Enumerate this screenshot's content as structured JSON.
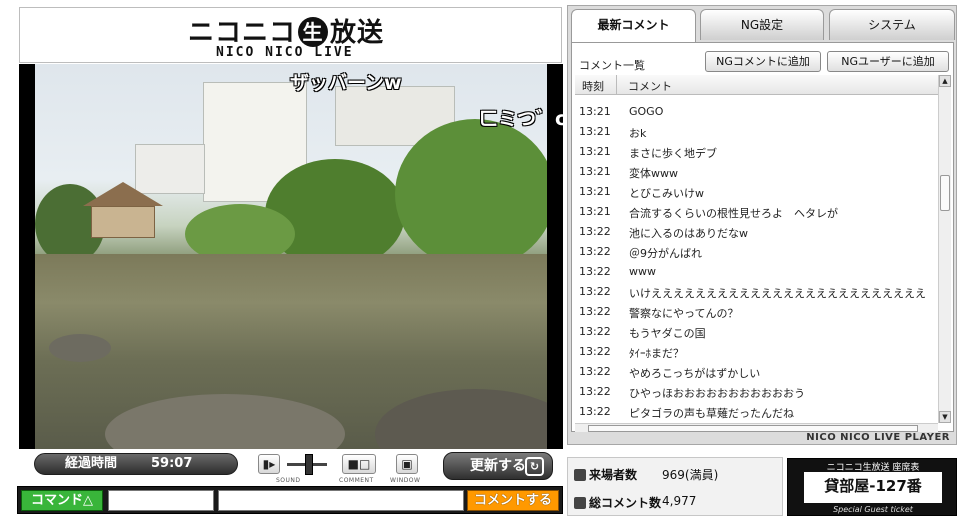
{
  "logo": {
    "main_a": "ニコニコ",
    "main_sei": "生",
    "main_b": "放送",
    "sub": "NICO NICO LIVE"
  },
  "video": {
    "overlay_comments": [
      "ザッバーンw",
      "ㄈミつ゛c"
    ]
  },
  "controls": {
    "elapsed_label": "経過時間",
    "elapsed_value": "59:07",
    "sound_label": "SOUND",
    "comment_label": "COMMENT",
    "window_label": "WINDOW",
    "refresh_label": "更新する"
  },
  "comment_bar": {
    "command_button": "コマンド△",
    "command_value": "",
    "comment_value": "",
    "send_button": "コメントする"
  },
  "tabs": [
    "最新コメント",
    "NG設定",
    "システム"
  ],
  "comment_panel": {
    "list_title": "コメント一覧",
    "ng_comment_button": "NGコメントに追加",
    "ng_user_button": "NGユーザーに追加",
    "headers": {
      "time": "時刻",
      "comment": "コメント"
    },
    "rows": [
      {
        "time": "13:21",
        "comment": "GOGO"
      },
      {
        "time": "13:21",
        "comment": "おk"
      },
      {
        "time": "13:21",
        "comment": "まさに歩く地デブ"
      },
      {
        "time": "13:21",
        "comment": "変体www"
      },
      {
        "time": "13:21",
        "comment": "とびこみいけw"
      },
      {
        "time": "13:21",
        "comment": "合流するくらいの根性見せろよ　ヘタレが"
      },
      {
        "time": "13:22",
        "comment": "池に入るのはありだなw"
      },
      {
        "time": "13:22",
        "comment": "＠9分がんばれ"
      },
      {
        "time": "13:22",
        "comment": "www"
      },
      {
        "time": "13:22",
        "comment": "いけえええええええええええええええええええええええええ"
      },
      {
        "time": "13:22",
        "comment": "警察なにやってんの？"
      },
      {
        "time": "13:22",
        "comment": "もうヤダこの国"
      },
      {
        "time": "13:22",
        "comment": "ﾀｲｰﾎまだ？"
      },
      {
        "time": "13:22",
        "comment": "やめろこっちがはずかしい"
      },
      {
        "time": "13:22",
        "comment": "ひやっほおおおおおおおおおおおう"
      },
      {
        "time": "13:22",
        "comment": "ピタゴラの声も草薙だったんだね"
      }
    ],
    "footer": "NICO NICO LIVE PLAYER"
  },
  "stats": {
    "visitors_label": "来場者数",
    "visitors_value": "969(満員)",
    "comments_label": "総コメント数",
    "comments_value": "4,977"
  },
  "seat": {
    "header": "ニコニコ生放送 座席表",
    "room": "貸部屋-127番",
    "footer": "Special Guest ticket"
  },
  "colors": {
    "command_green": "#39b53a",
    "send_orange": "#ff9900",
    "panel_gray": "#dcdcdc"
  }
}
